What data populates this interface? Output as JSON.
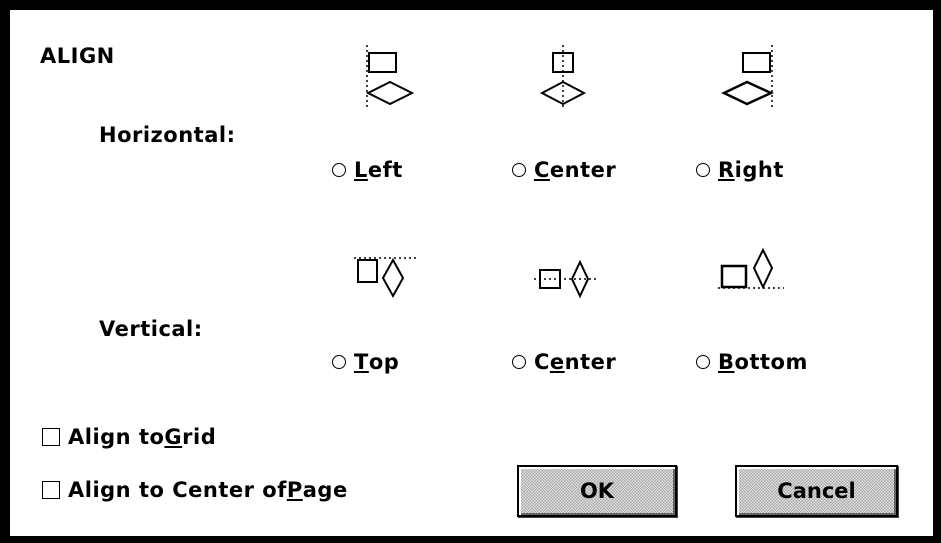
{
  "dialog": {
    "title": "ALIGN",
    "horizontal": {
      "label": "Horizontal:",
      "options": [
        {
          "prefix": "",
          "accel": "L",
          "suffix": "eft",
          "icon": "align-left-icon"
        },
        {
          "prefix": "",
          "accel": "C",
          "suffix": "enter",
          "icon": "align-horizontal-center-icon"
        },
        {
          "prefix": "",
          "accel": "R",
          "suffix": "ight",
          "icon": "align-right-icon"
        }
      ]
    },
    "vertical": {
      "label": "Vertical:",
      "options": [
        {
          "prefix": "",
          "accel": "T",
          "suffix": "op",
          "icon": "align-top-icon"
        },
        {
          "prefix": "C",
          "accel": "e",
          "suffix": "nter",
          "icon": "align-vertical-center-icon"
        },
        {
          "prefix": "",
          "accel": "B",
          "suffix": "ottom",
          "icon": "align-bottom-icon"
        }
      ]
    },
    "align_to_grid": {
      "prefix": "Align to ",
      "accel": "G",
      "suffix": "rid",
      "checked": false
    },
    "align_to_page": {
      "prefix": "Align to Center of ",
      "accel": "P",
      "suffix": "age",
      "checked": false
    },
    "buttons": {
      "ok": "OK",
      "cancel": "Cancel"
    }
  }
}
